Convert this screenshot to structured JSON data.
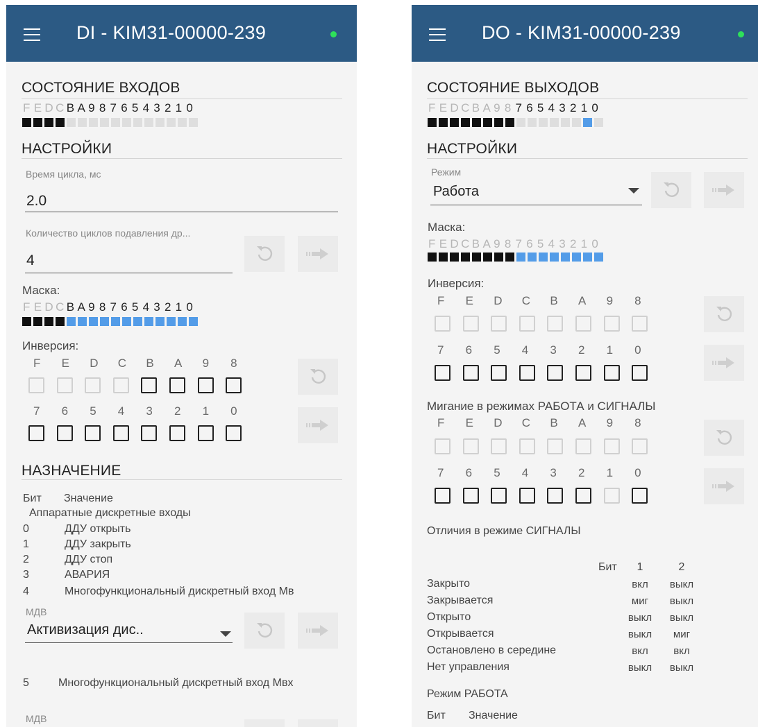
{
  "bit_labels": [
    "F",
    "E",
    "D",
    "C",
    "B",
    "A",
    "9",
    "8",
    "7",
    "6",
    "5",
    "4",
    "3",
    "2",
    "1",
    "0"
  ],
  "inv_labels_high": [
    "F",
    "E",
    "D",
    "C",
    "B",
    "A",
    "9",
    "8"
  ],
  "inv_labels_low": [
    "7",
    "6",
    "5",
    "4",
    "3",
    "2",
    "1",
    "0"
  ],
  "colors": {
    "appbar": "#2c5a84",
    "status_dot": "#2ee05a",
    "bit_on": "#111111",
    "bit_mask": "#539ce8",
    "bit_off": "#dedede"
  },
  "left": {
    "title": "DI - KIM31-00000-239",
    "state_header": "СОСТОЯНИЕ ВХОДОВ",
    "state_enabled": [
      false,
      false,
      false,
      false,
      true,
      true,
      true,
      true,
      true,
      true,
      true,
      true,
      true,
      true,
      true,
      true
    ],
    "state_boxes": [
      "on",
      "on",
      "on",
      "on",
      "off",
      "off",
      "off",
      "off",
      "off",
      "off",
      "off",
      "off",
      "off",
      "off",
      "off",
      "off"
    ],
    "settings_header": "НАСТРОЙКИ",
    "cycle_time_label": "Время цикла, мс",
    "cycle_time_value": "2.0",
    "suppress_label": "Количество циклов подавления др...",
    "suppress_value": "4",
    "mask_label": "Маска:",
    "mask_enabled": [
      false,
      false,
      false,
      false,
      true,
      true,
      true,
      true,
      true,
      true,
      true,
      true,
      true,
      true,
      true,
      true
    ],
    "mask_boxes": [
      "on",
      "on",
      "on",
      "on",
      "blue",
      "blue",
      "blue",
      "blue",
      "blue",
      "blue",
      "blue",
      "blue",
      "blue",
      "blue",
      "blue",
      "blue"
    ],
    "inversion_label": "Инверсия:",
    "inversion_high_disabled": [
      true,
      true,
      true,
      true,
      false,
      false,
      false,
      false
    ],
    "inversion_low_disabled": [
      false,
      false,
      false,
      false,
      false,
      false,
      false,
      false
    ],
    "assignment_header": "НАЗНАЧЕНИЕ",
    "col_bit": "Бит",
    "col_value": "Значение",
    "group_title": "Аппаратные дискретные входы",
    "assignments": [
      {
        "bit": "0",
        "value": "ДДУ открыть"
      },
      {
        "bit": "1",
        "value": "ДДУ закрыть"
      },
      {
        "bit": "2",
        "value": "ДДУ стоп"
      },
      {
        "bit": "3",
        "value": "АВАРИЯ"
      },
      {
        "bit": "4",
        "value": "Многофункциональный дискретный вход Мв"
      }
    ],
    "mdv_label": "МДВ",
    "mdv_value": "Активизация дис..",
    "item5_bit": "5",
    "item5_value": "Многофункциональный дискретный вход Мвх",
    "mdv2_label": "МДВ"
  },
  "right": {
    "title": "DO - KIM31-00000-239",
    "state_header": "СОСТОЯНИЕ ВЫХОДОВ",
    "state_enabled": [
      false,
      false,
      false,
      false,
      false,
      false,
      false,
      false,
      true,
      true,
      true,
      true,
      true,
      true,
      true,
      true
    ],
    "state_boxes": [
      "on",
      "on",
      "on",
      "on",
      "on",
      "on",
      "on",
      "on",
      "off",
      "off",
      "off",
      "off",
      "off",
      "off",
      "blue",
      "off"
    ],
    "settings_header": "НАСТРОЙКИ",
    "mode_label": "Режим",
    "mode_value": "Работа",
    "mask_label": "Маска:",
    "mask_enabled": [
      false,
      false,
      false,
      false,
      false,
      false,
      false,
      false,
      false,
      false,
      false,
      false,
      false,
      false,
      false,
      false
    ],
    "mask_boxes": [
      "on",
      "on",
      "on",
      "on",
      "on",
      "on",
      "on",
      "on",
      "blue",
      "blue",
      "blue",
      "blue",
      "blue",
      "blue",
      "blue",
      "blue"
    ],
    "inversion_label": "Инверсия:",
    "inversion_high_disabled": [
      true,
      true,
      true,
      true,
      true,
      true,
      true,
      true
    ],
    "inversion_low_disabled": [
      false,
      false,
      false,
      false,
      false,
      false,
      false,
      false
    ],
    "blink_label": "Мигание в режимах РАБОТА и СИГНАЛЫ",
    "blink_high_disabled": [
      true,
      true,
      true,
      true,
      true,
      true,
      true,
      true
    ],
    "blink_low_disabled": [
      false,
      false,
      false,
      false,
      false,
      false,
      true,
      false
    ],
    "signals_diff_label": "Отличия в режиме СИГНАЛЫ",
    "table": {
      "col_bit": "Бит",
      "col_1": "1",
      "col_2": "2",
      "rows": [
        {
          "name": "Закрыто",
          "b1": "вкл",
          "b2": "выкл"
        },
        {
          "name": "Закрывается",
          "b1": "миг",
          "b2": "выкл"
        },
        {
          "name": "Открыто",
          "b1": "выкл",
          "b2": "выкл"
        },
        {
          "name": "Открывается",
          "b1": "выкл",
          "b2": "миг"
        },
        {
          "name": "Остановлено в середине",
          "b1": "вкл",
          "b2": "вкл"
        },
        {
          "name": "Нет управления",
          "b1": "выкл",
          "b2": "выкл"
        }
      ]
    },
    "work_mode_label": "Режим РАБОТА",
    "col_bit": "Бит",
    "col_value": "Значение"
  }
}
